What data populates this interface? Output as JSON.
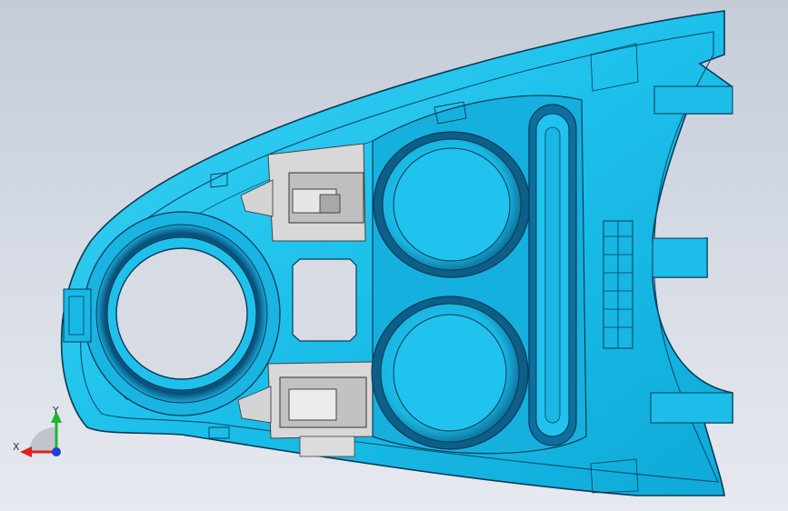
{
  "viewport": {
    "background_top": "#c4ccd8",
    "background_bottom": "#e6e9ef"
  },
  "model": {
    "part": "console-panel",
    "base_color": "#19bfe8",
    "dark_color": "#0a6e9a",
    "edge_color": "#0a3a55",
    "clip_color": "#c9c9c9",
    "hole_color": "#d6dbe4"
  },
  "triad": {
    "x_label": "X",
    "y_label": "Y",
    "x_color": "#e0201e",
    "y_color": "#21b430",
    "z_color": "#1d3fd8"
  }
}
